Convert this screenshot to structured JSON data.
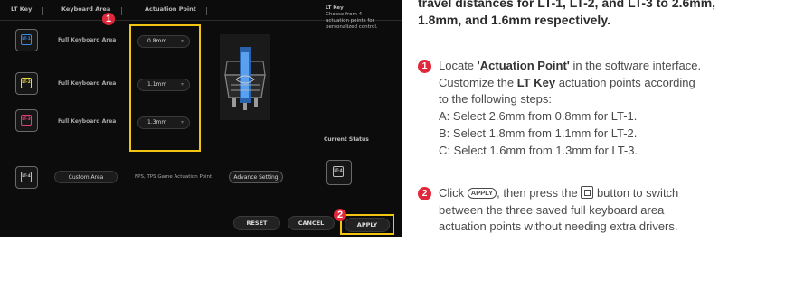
{
  "screenshot": {
    "header": {
      "col1": "LT Key",
      "col2": "Keyboard Area",
      "col3": "Actuation Point"
    },
    "side_info": {
      "title": "LT Key",
      "body": "Choose from 4 actuation points for personalized control."
    },
    "rows": [
      {
        "key_label": "LT-1",
        "area": "Full Keyboard Area",
        "value": "0.8mm",
        "cap_color": "#3c8be0"
      },
      {
        "key_label": "LT-2",
        "area": "Full Keyboard Area",
        "value": "1.1mm",
        "cap_color": "#e8d84a"
      },
      {
        "key_label": "LT-3",
        "area": "Full Keyboard Area",
        "value": "1.3mm",
        "cap_color": "#e0407a"
      }
    ],
    "custom_row": {
      "key_label": "LT-4",
      "area": "Custom Area",
      "info": "FPS, TPS Game Actuation Point",
      "button": "Advance Setting"
    },
    "current_status_label": "Current Status",
    "buttons": {
      "reset": "RESET",
      "cancel": "CANCEL",
      "apply": "APPLY"
    },
    "badges": {
      "one": "1",
      "two": "2"
    },
    "colors": {
      "highlight": "#f2c511",
      "badge": "#e0283a",
      "background": "#0c0c0c"
    }
  },
  "instructions": {
    "lead_line1": "travel distances for LT-1, LT-2, and LT-3 to 2.6mm,",
    "lead_line2": "1.8mm, and 1.6mm respectively.",
    "step1": {
      "num": "1",
      "text_a": "Locate ",
      "bold_a": "'Actuation Point'",
      "text_b": " in the software interface.",
      "text_c": "Customize the ",
      "bold_b": "LT Key",
      "text_d": " actuation points according",
      "text_e": "to the following steps:",
      "sub": [
        "A: Select 2.6mm from 0.8mm for LT-1.",
        "B: Select 1.8mm from 1.1mm for LT-2.",
        "C: Select 1.6mm from 1.3mm for LT-3."
      ]
    },
    "step2": {
      "num": "2",
      "text_a": "Click ",
      "apply_icon": "APPLY",
      "text_b": ", then press the ",
      "key_icon": "keyboard-key-icon",
      "text_c": " button to switch",
      "line2": "between the three saved full keyboard area",
      "line3": "actuation points without needing extra drivers."
    }
  }
}
